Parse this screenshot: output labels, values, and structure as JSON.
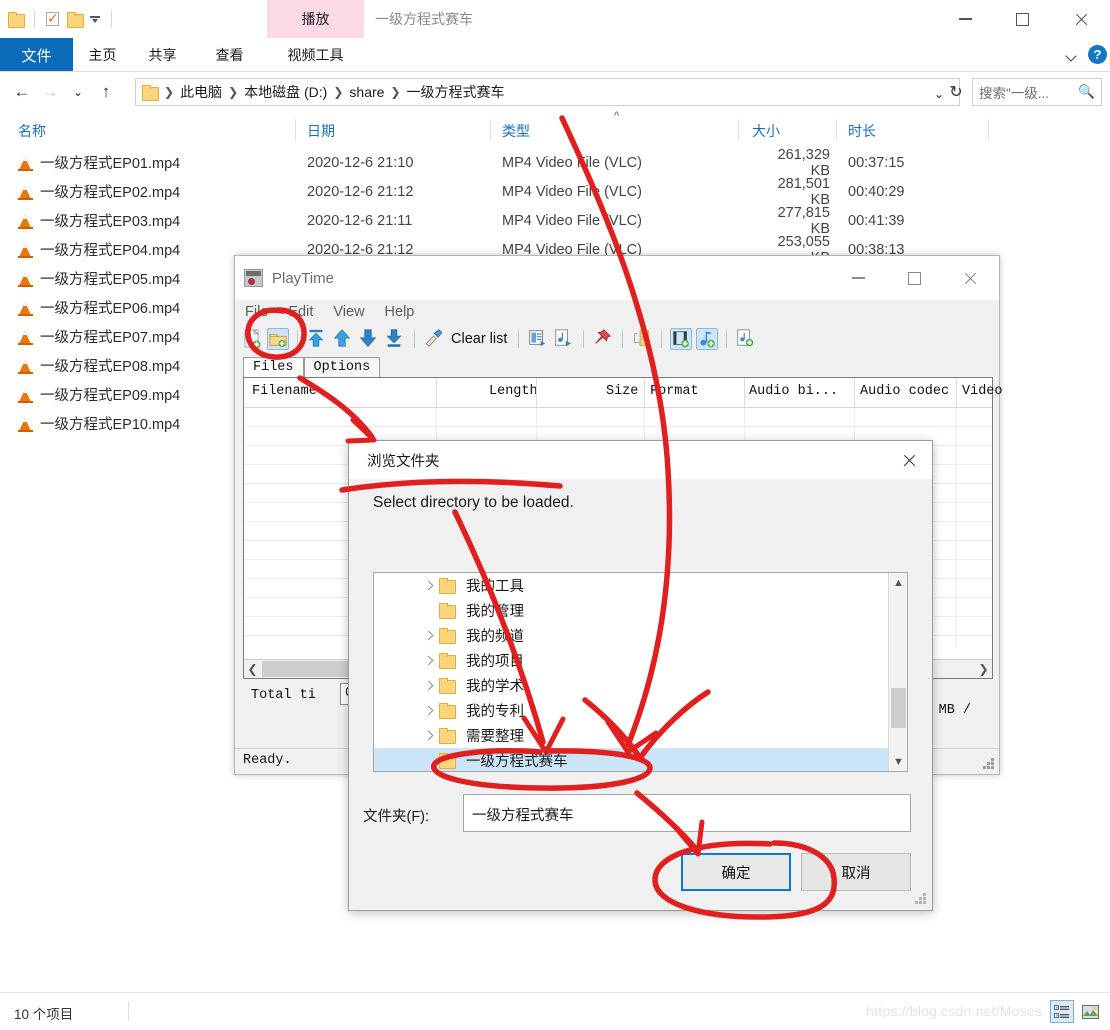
{
  "explorer": {
    "quick_access": [
      {
        "name": "folder-icon",
        "label": ""
      },
      {
        "name": "properties-icon",
        "label": ""
      },
      {
        "name": "new-folder-icon",
        "label": ""
      },
      {
        "name": "chevron-down-icon",
        "label": ""
      }
    ],
    "context_tab_group": "视频工具",
    "context_tab_label": "播放",
    "window_title": "一级方程式赛车",
    "ribbon_tabs": [
      {
        "label": "文件",
        "active": true
      },
      {
        "label": "主页",
        "active": false
      },
      {
        "label": "共享",
        "active": false
      },
      {
        "label": "查看",
        "active": false
      }
    ],
    "help_label": "?",
    "breadcrumbs": [
      "此电脑",
      "本地磁盘 (D:)",
      "share",
      "一级方程式赛车"
    ],
    "search_placeholder": "搜索\"一级...",
    "columns": [
      "名称",
      "日期",
      "类型",
      "大小",
      "时长"
    ],
    "sort_column": "类型",
    "sort_direction": "asc",
    "files": [
      {
        "name": "一级方程式EP01.mp4",
        "date": "2020-12-6 21:10",
        "type": "MP4 Video File (VLC)",
        "size": "261,329 KB",
        "duration": "00:37:15"
      },
      {
        "name": "一级方程式EP02.mp4",
        "date": "2020-12-6 21:12",
        "type": "MP4 Video File (VLC)",
        "size": "281,501 KB",
        "duration": "00:40:29"
      },
      {
        "name": "一级方程式EP03.mp4",
        "date": "2020-12-6 21:11",
        "type": "MP4 Video File (VLC)",
        "size": "277,815 KB",
        "duration": "00:41:39"
      },
      {
        "name": "一级方程式EP04.mp4",
        "date": "2020-12-6 21:12",
        "type": "MP4 Video File (VLC)",
        "size": "253,055 KB",
        "duration": "00:38:13"
      },
      {
        "name": "一级方程式EP05.mp4",
        "date": "",
        "type": "",
        "size": "",
        "duration": ""
      },
      {
        "name": "一级方程式EP06.mp4",
        "date": "",
        "type": "",
        "size": "",
        "duration": ""
      },
      {
        "name": "一级方程式EP07.mp4",
        "date": "",
        "type": "",
        "size": "",
        "duration": ""
      },
      {
        "name": "一级方程式EP08.mp4",
        "date": "",
        "type": "",
        "size": "",
        "duration": ""
      },
      {
        "name": "一级方程式EP09.mp4",
        "date": "",
        "type": "",
        "size": "",
        "duration": ""
      },
      {
        "name": "一级方程式EP10.mp4",
        "date": "",
        "type": "",
        "size": "",
        "duration": ""
      }
    ],
    "status_text": "10 个项目",
    "watermark": "https://blog.csdn.net/Moses",
    "view_buttons": [
      "details-view-icon",
      "large-icons-view-icon"
    ]
  },
  "playtime": {
    "title": "PlayTime",
    "menu": [
      "File",
      "Edit",
      "View",
      "Help"
    ],
    "toolbar": [
      {
        "name": "new-file-icon",
        "label": ""
      },
      {
        "name": "open-folder-icon",
        "label": ""
      },
      {
        "name": "move-top-icon",
        "label": ""
      },
      {
        "name": "move-up-icon",
        "label": ""
      },
      {
        "name": "move-down-icon",
        "label": ""
      },
      {
        "name": "move-bottom-icon",
        "label": ""
      },
      {
        "name": "clear-list-icon",
        "label": "Clear list"
      },
      {
        "name": "export-list-icon",
        "label": ""
      },
      {
        "name": "export-playlist-icon",
        "label": ""
      },
      {
        "name": "pin-icon",
        "label": ""
      },
      {
        "name": "group-folders-icon",
        "label": ""
      },
      {
        "name": "add-video-icon",
        "label": ""
      },
      {
        "name": "add-audio-icon",
        "label": ""
      },
      {
        "name": "add-playlist-icon",
        "label": ""
      }
    ],
    "clear_list_label": "Clear list",
    "tabs": [
      {
        "label": "Files",
        "active": true
      },
      {
        "label": "Options",
        "active": false
      }
    ],
    "list_columns": [
      "Filename",
      "Length",
      "Size",
      "Format",
      "Audio bi...",
      "Audio codec",
      "Video"
    ],
    "total_label": "Total ti",
    "total_value": "00:",
    "mb_label": "MB /",
    "status": "Ready."
  },
  "dialog": {
    "title": "浏览文件夹",
    "prompt": "Select directory to be loaded.",
    "tree": [
      {
        "label": "我的工具",
        "expandable": true,
        "selected": false
      },
      {
        "label": "我的管理",
        "expandable": false,
        "selected": false
      },
      {
        "label": "我的频道",
        "expandable": true,
        "selected": false
      },
      {
        "label": "我的项目",
        "expandable": true,
        "selected": false
      },
      {
        "label": "我的学术",
        "expandable": true,
        "selected": false
      },
      {
        "label": "我的专利",
        "expandable": true,
        "selected": false
      },
      {
        "label": "需要整理",
        "expandable": true,
        "selected": false
      },
      {
        "label": "一级方程式赛车",
        "expandable": false,
        "selected": true
      }
    ],
    "folder_label": "文件夹(F):",
    "folder_value": "一级方程式赛车",
    "ok_label": "确定",
    "cancel_label": "取消"
  },
  "annotations": {
    "color": "#e01f1f",
    "marks": [
      "circle-around-open-folder-toolbar-button",
      "arrow-from-files-tab-to-dialog-title",
      "long-curve-from-explorer-to-selected-folder",
      "arrow-pointing-to-selected-folder-row",
      "ellipse-around-selected-folder-row",
      "arrow-pointing-to-ok-button",
      "ellipse-around-ok-button"
    ]
  }
}
